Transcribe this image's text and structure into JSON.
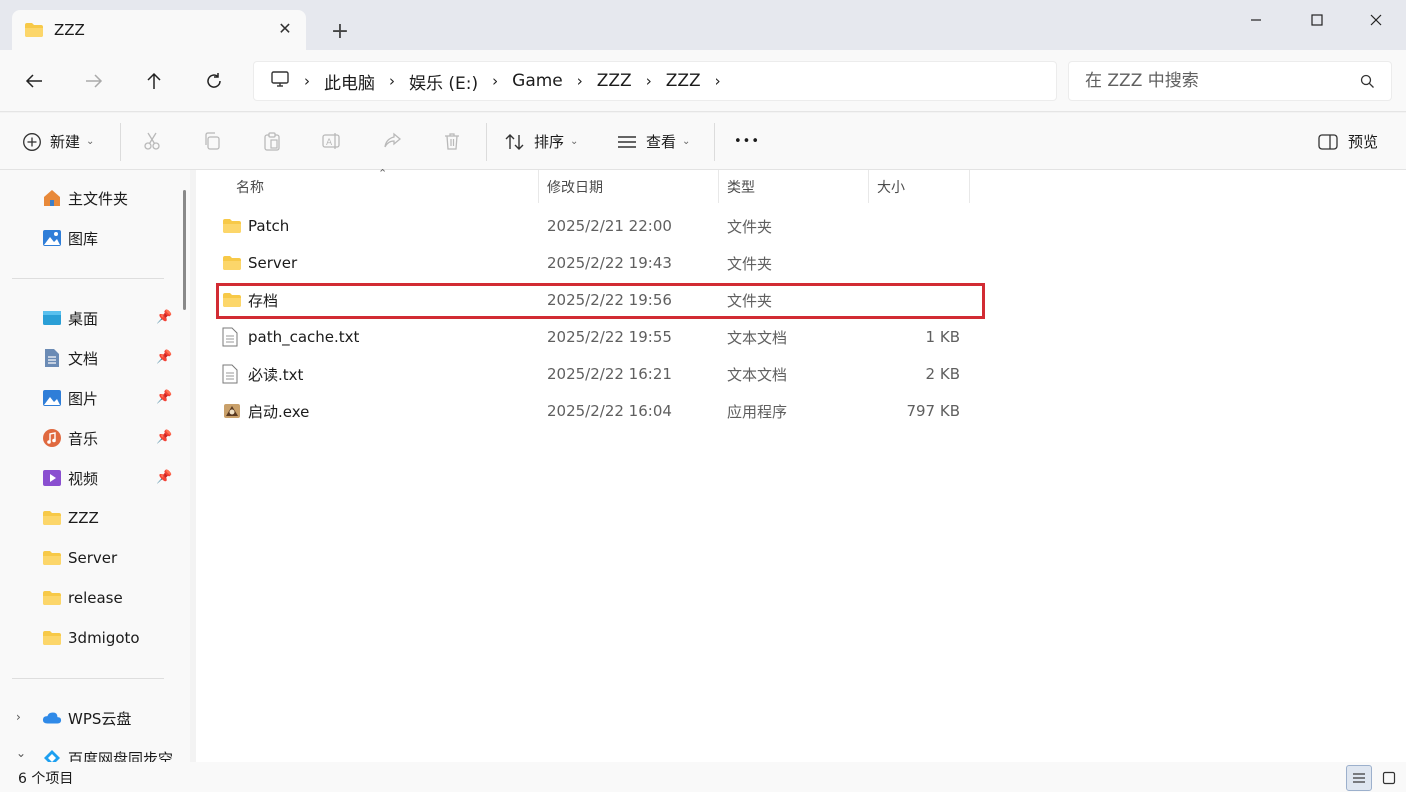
{
  "window": {
    "tab_title": "ZZZ",
    "tab_close": "✕",
    "new_tab": "+",
    "minimize": "—",
    "close": "✕"
  },
  "address": {
    "crumbs": [
      "此电脑",
      "娱乐 (E:)",
      "Game",
      "ZZZ",
      "ZZZ"
    ],
    "search_placeholder": "在 ZZZ 中搜索"
  },
  "toolbar": {
    "new_label": "新建",
    "sort_label": "排序",
    "view_label": "查看",
    "more_label": "•••",
    "preview_label": "预览"
  },
  "sidebar": {
    "quick": [
      {
        "label": "主文件夹",
        "icon": "home-icon"
      },
      {
        "label": "图库",
        "icon": "gallery-icon"
      }
    ],
    "pinned": [
      {
        "label": "桌面",
        "icon": "desktop-icon",
        "pinned": true
      },
      {
        "label": "文档",
        "icon": "document-icon",
        "pinned": true
      },
      {
        "label": "图片",
        "icon": "pictures-icon",
        "pinned": true
      },
      {
        "label": "音乐",
        "icon": "music-icon",
        "pinned": true
      },
      {
        "label": "视频",
        "icon": "video-icon",
        "pinned": true
      },
      {
        "label": "ZZZ",
        "icon": "folder-icon",
        "pinned": false
      },
      {
        "label": "Server",
        "icon": "folder-icon",
        "pinned": false
      },
      {
        "label": "release",
        "icon": "folder-icon",
        "pinned": false
      },
      {
        "label": "3dmigoto",
        "icon": "folder-icon",
        "pinned": false
      }
    ],
    "cloud": [
      {
        "label": "WPS云盘",
        "icon": "cloud-icon",
        "expander": "›"
      },
      {
        "label": "百度网盘同步空",
        "icon": "baidu-icon",
        "expander": "⌄"
      }
    ]
  },
  "columns": {
    "name": "名称",
    "date": "修改日期",
    "type": "类型",
    "size": "大小"
  },
  "files": [
    {
      "name": "Patch",
      "date": "2025/2/21 22:00",
      "type": "文件夹",
      "size": "",
      "icon": "folder-icon"
    },
    {
      "name": "Server",
      "date": "2025/2/22 19:43",
      "type": "文件夹",
      "size": "",
      "icon": "folder-icon"
    },
    {
      "name": "存档",
      "date": "2025/2/22 19:56",
      "type": "文件夹",
      "size": "",
      "icon": "folder-icon",
      "highlighted": true
    },
    {
      "name": "path_cache.txt",
      "date": "2025/2/22 19:55",
      "type": "文本文档",
      "size": "1 KB",
      "icon": "text-file-icon"
    },
    {
      "name": "必读.txt",
      "date": "2025/2/22 16:21",
      "type": "文本文档",
      "size": "2 KB",
      "icon": "text-file-icon"
    },
    {
      "name": "启动.exe",
      "date": "2025/2/22 16:04",
      "type": "应用程序",
      "size": "797 KB",
      "icon": "exe-icon"
    }
  ],
  "status": {
    "item_count": "6 个项目"
  },
  "colors": {
    "highlight_border": "#d22b33",
    "folder_yellow": "#f7c948"
  }
}
